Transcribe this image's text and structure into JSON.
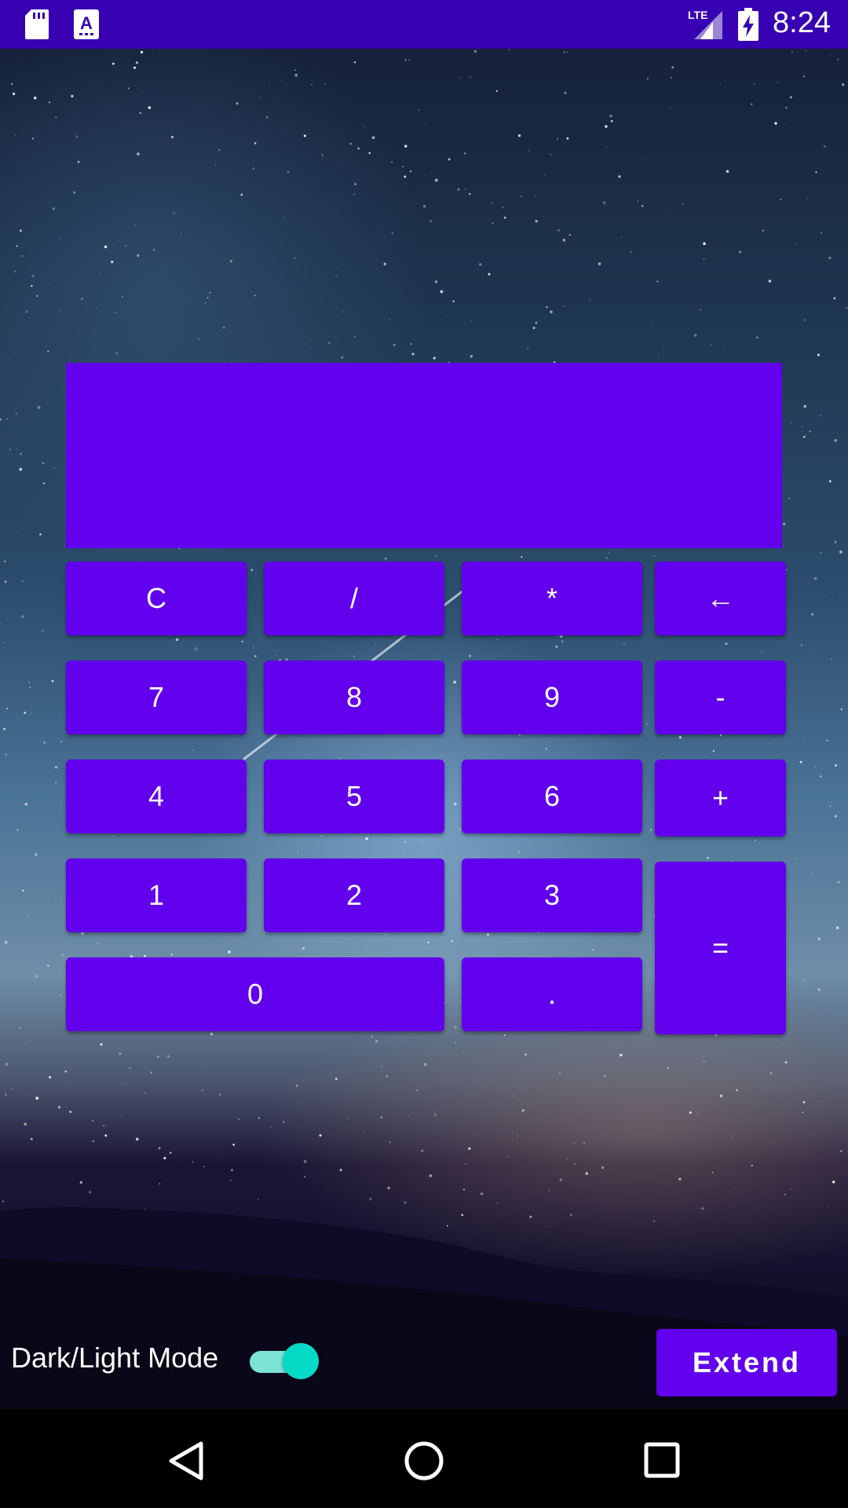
{
  "status_bar": {
    "time": "8:24",
    "network": "LTE",
    "icons": [
      "sd-card-icon",
      "keyboard-a-icon",
      "lte-signal-icon",
      "battery-charging-icon"
    ]
  },
  "calculator": {
    "display_value": "",
    "buttons": {
      "clear": "C",
      "divide": "/",
      "multiply": "*",
      "backspace": "←",
      "seven": "7",
      "eight": "8",
      "nine": "9",
      "minus": "-",
      "four": "4",
      "five": "5",
      "six": "6",
      "plus": "+",
      "one": "1",
      "two": "2",
      "three": "3",
      "equals": "=",
      "zero": "0",
      "decimal": "."
    }
  },
  "bottom": {
    "mode_label": "Dark/Light Mode",
    "mode_toggle_on": true,
    "extend_label": "Extend"
  },
  "nav_bar": {
    "icons": [
      "back-triangle-icon",
      "home-circle-icon",
      "recents-square-icon"
    ]
  },
  "colors": {
    "status_bar": "#3700b3",
    "primary": "#6200ee",
    "toggle_accent": "#03dac5"
  }
}
